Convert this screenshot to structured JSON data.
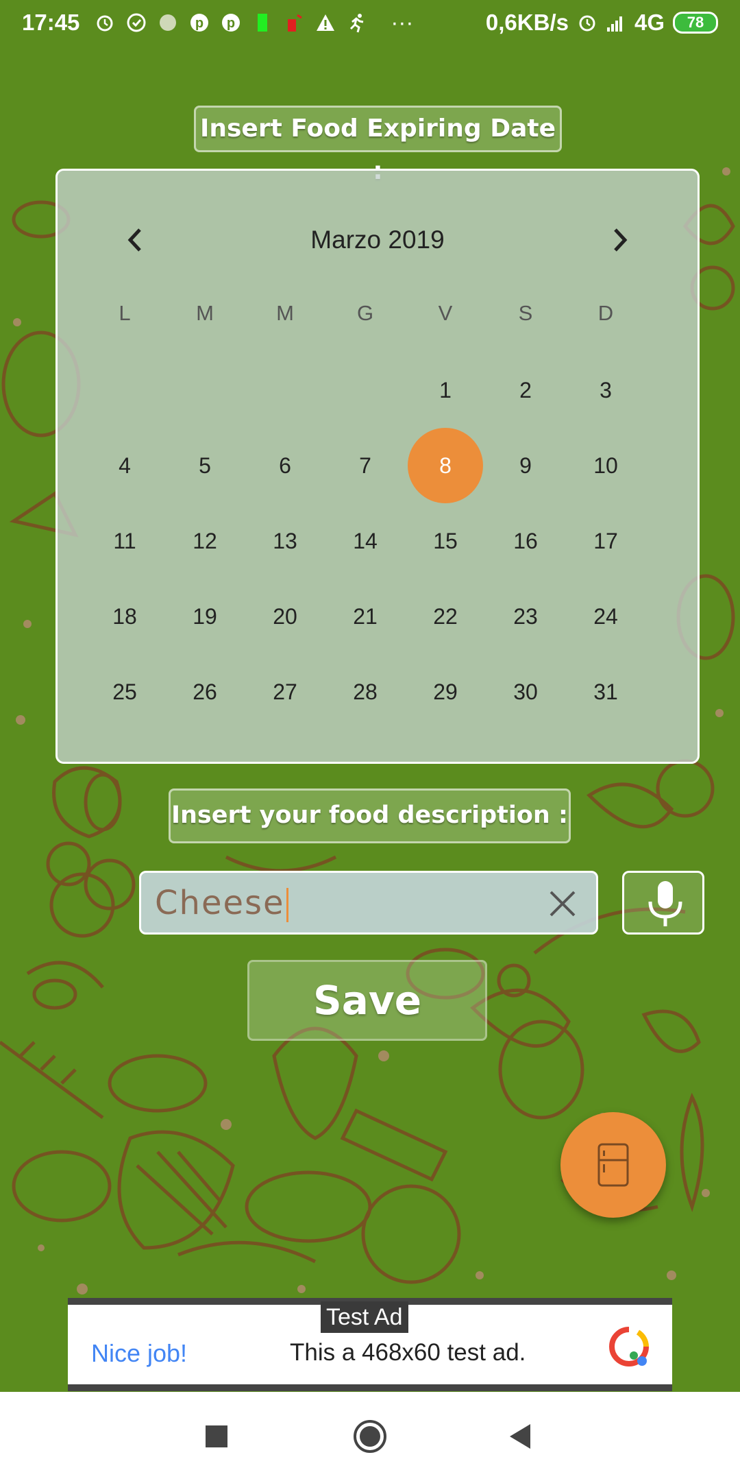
{
  "status_bar": {
    "time": "17:45",
    "net_speed": "0,6KB/s",
    "network": "4G",
    "battery": "78"
  },
  "date_label": "Insert Food Expiring Date :",
  "calendar": {
    "month_title": "Marzo 2019",
    "weekdays": [
      "L",
      "M",
      "M",
      "G",
      "V",
      "S",
      "D"
    ],
    "days": [
      "1",
      "2",
      "3",
      "4",
      "5",
      "6",
      "7",
      "8",
      "9",
      "10",
      "11",
      "12",
      "13",
      "14",
      "15",
      "16",
      "17",
      "18",
      "19",
      "20",
      "21",
      "22",
      "23",
      "24",
      "25",
      "26",
      "27",
      "28",
      "29",
      "30",
      "31"
    ],
    "first_weekday_index": 4,
    "selected_day": "8",
    "accent_color": "#ec8e3a"
  },
  "desc_label": "Insert your food description :",
  "food_input": {
    "value": "Cheese"
  },
  "save_label": "Save",
  "ad": {
    "tag": "Test Ad",
    "headline": "Nice job!",
    "body": "This a 468x60 test ad."
  },
  "colors": {
    "background": "#5b8c1e",
    "doodle": "#7a4a22",
    "accent": "#ec8e3a"
  }
}
